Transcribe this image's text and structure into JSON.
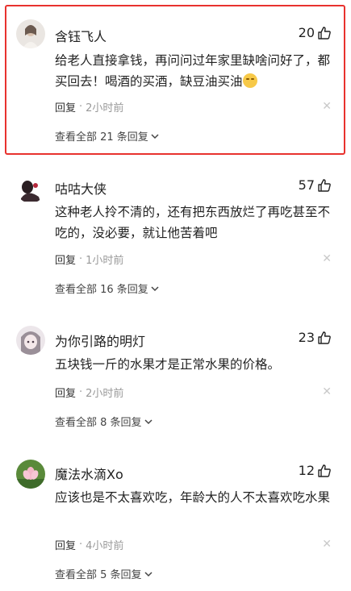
{
  "colors": {
    "highlight_border": "#e8322e",
    "meta_gray": "#999999",
    "text": "#222222"
  },
  "comments": [
    {
      "username": "含钰飞人",
      "likes": "20",
      "content": "给老人直接拿钱，再问问过年家里缺啥问好了，都买回去！喝酒的买酒，缺豆油买油",
      "emoji": "smirk-emoji",
      "reply_label": "回复",
      "time": "2小时前",
      "replies_label": "查看全部 21 条回复",
      "avatar_icon": "avatar-woman-photo"
    },
    {
      "username": "咕咕大侠",
      "likes": "57",
      "content": "这种老人拎不清的，还有把东西放烂了再吃甚至不吃的，没必要，就让他苦着吧",
      "reply_label": "回复",
      "time": "1小时前",
      "replies_label": "查看全部 16 条回复",
      "avatar_icon": "avatar-dark-figure"
    },
    {
      "username": "为你引路的明灯",
      "likes": "23",
      "content": "五块钱一斤的水果才是正常水果的价格。",
      "reply_label": "回复",
      "time": "2小时前",
      "replies_label": "查看全部 8 条回复",
      "avatar_icon": "avatar-anime-girl"
    },
    {
      "username": "魔法水滴Xo",
      "likes": "12",
      "content": "应该也是不太喜欢吃，年龄大的人不太喜欢吃水果",
      "reply_label": "回复",
      "time": "4小时前",
      "replies_label": "查看全部 5 条回复",
      "avatar_icon": "avatar-lotus-flower"
    }
  ]
}
